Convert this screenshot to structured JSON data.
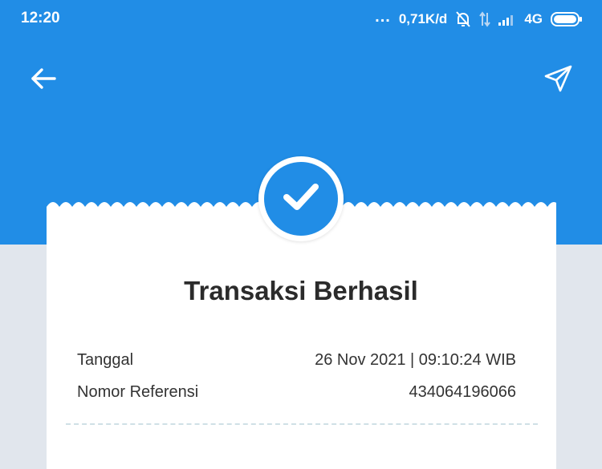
{
  "status_bar": {
    "time": "12:20",
    "dots": "...",
    "speed": "0,71K/d",
    "network": "4G",
    "icons": [
      "mute-bell-icon",
      "data-arrows-icon",
      "signal-icon",
      "battery-icon"
    ]
  },
  "app_bar": {
    "icons": [
      "back-arrow-icon",
      "send-icon"
    ]
  },
  "colors": {
    "primary": "#218de6",
    "background": "#e1e6ed",
    "card": "#ffffff",
    "text": "#2b2b2b"
  },
  "receipt": {
    "title": "Transaksi Berhasil",
    "rows": [
      {
        "label": "Tanggal",
        "value": "26 Nov 2021 | 09:10:24 WIB"
      },
      {
        "label": "Nomor Referensi",
        "value": "434064196066"
      }
    ]
  }
}
